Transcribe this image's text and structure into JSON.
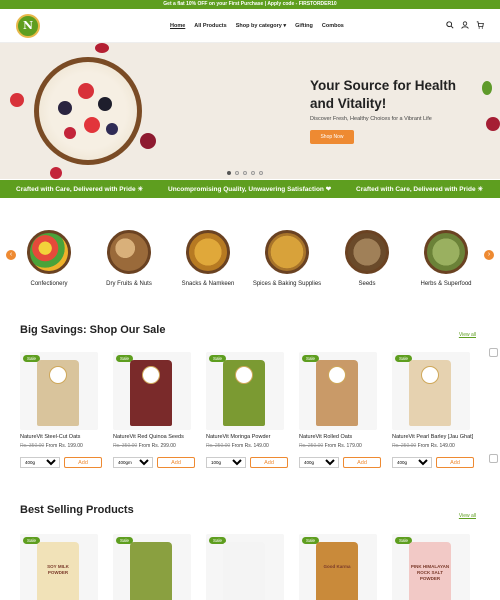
{
  "promo": "Get a flat 10% OFF on your First Purchase | Apply code - FIRSTORDER10",
  "logo": "N",
  "nav": [
    "Home",
    "All Products",
    "Shop by category",
    "Gifting",
    "Combos"
  ],
  "hero": {
    "title_line1": "Your Source for Health",
    "title_line2": "and Vitality!",
    "subtitle": "Discover Fresh, Healthy Choices for a Vibrant Life",
    "cta": "Shop Now"
  },
  "ticker": [
    "Crafted with Care, Delivered with Pride ☀",
    "Uncompromising Quality, Unwavering Satisfaction ❤",
    "Crafted with Care, Delivered with Pride ☀"
  ],
  "categories": [
    {
      "label": "Confectionery",
      "color": "#e9c23a"
    },
    {
      "label": "Dry Fruits & Nuts",
      "color": "#b07a46"
    },
    {
      "label": "Snacks & Namkeen",
      "color": "#d89a2a"
    },
    {
      "label": "Spices & Baking Supplies",
      "color": "#d6a23a"
    },
    {
      "label": "Seeds",
      "color": "#8a6a44"
    },
    {
      "label": "Herbs & Superfood",
      "color": "#8aa356"
    }
  ],
  "sale_section": {
    "title": "Big Savings: Shop Our Sale",
    "view_all": "View all",
    "badge": "Sale",
    "add_label": "Add",
    "products": [
      {
        "name": "NatureVit Steel-Cut Oats",
        "was": "Rs. 350.00",
        "from": "From Rs. 199.00",
        "size": "400g",
        "color": "#d9c49c"
      },
      {
        "name": "NatureVit Red Quinoa Seeds",
        "was": "Rs. 350.00",
        "from": "From Rs. 299.00",
        "size": "400gm",
        "color": "#7a2a2a"
      },
      {
        "name": "NatureVit Moringa Powder",
        "was": "Rs. 250.00",
        "from": "From Rs. 149.00",
        "size": "100g",
        "color": "#7b9a32"
      },
      {
        "name": "NatureVit Rolled Oats",
        "was": "Rs. 250.00",
        "from": "From Rs. 179.00",
        "size": "400g",
        "color": "#c99a68"
      },
      {
        "name": "NatureVit Pearl Barley [Jau Ghat]",
        "was": "Rs. 250.00",
        "from": "From Rs. 149.00",
        "size": "400g",
        "color": "#e6d2b0"
      }
    ]
  },
  "best_section": {
    "title": "Best Selling Products",
    "view_all": "View all",
    "badge": "Sale",
    "products": [
      {
        "label": "SOY MILK POWDER",
        "color": "#f1e2b8"
      },
      {
        "label": "",
        "color": "#8aa040"
      },
      {
        "label": "",
        "color": "#f4f4f4"
      },
      {
        "label": "Good Karma",
        "color": "#c98a3a"
      },
      {
        "label": "PINK HIMALAYAN ROCK SALT POWDER",
        "color": "#f2c9c6"
      }
    ]
  }
}
